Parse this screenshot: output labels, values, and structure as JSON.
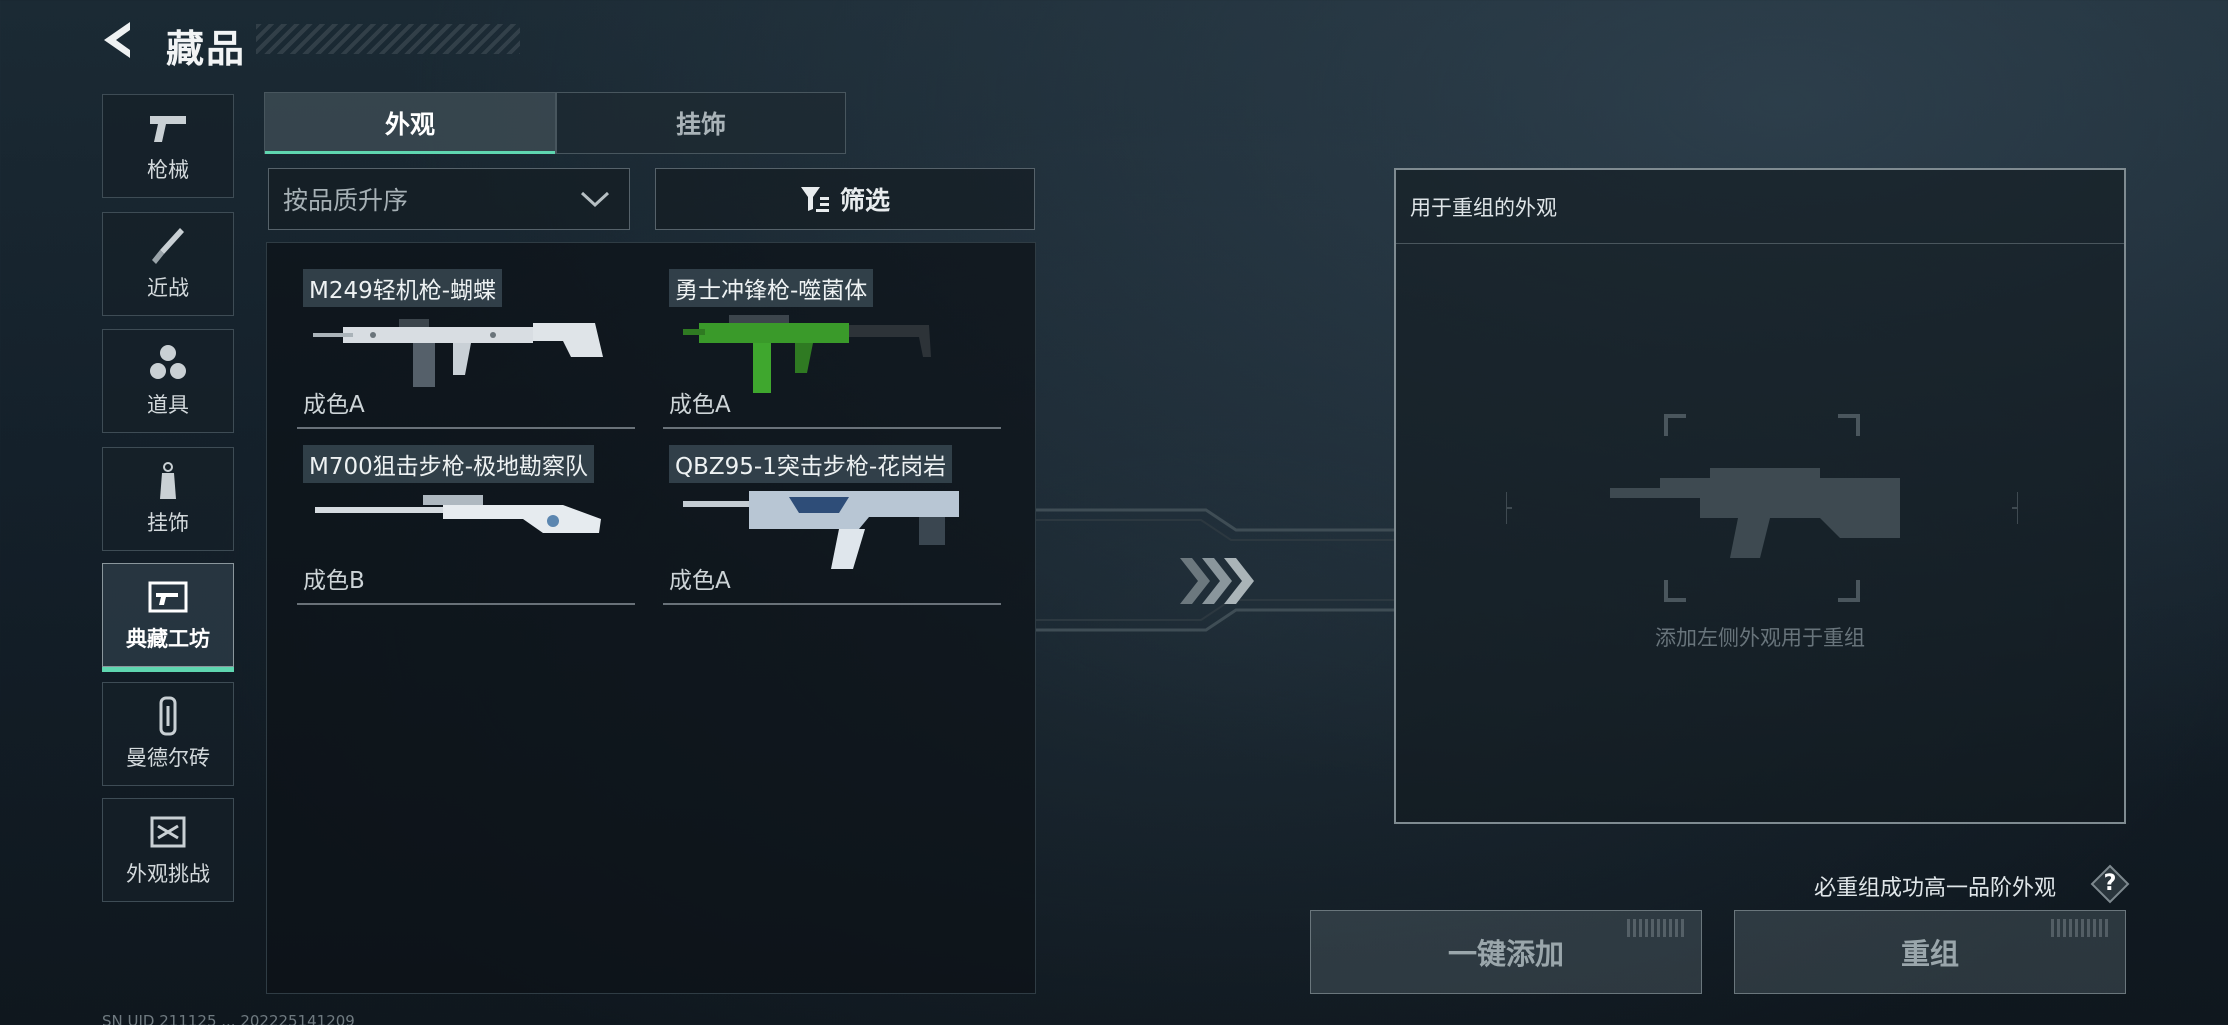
{
  "header": {
    "title": "藏品"
  },
  "sidebar": {
    "items": [
      {
        "label": "枪械",
        "icon": "pistol-icon"
      },
      {
        "label": "近战",
        "icon": "knife-icon"
      },
      {
        "label": "道具",
        "icon": "grenade-cluster-icon"
      },
      {
        "label": "挂饰",
        "icon": "charm-tag-icon"
      },
      {
        "label": "典藏工坊",
        "icon": "gun-frame-icon",
        "active": true
      },
      {
        "label": "曼德尔砖",
        "icon": "brick-icon"
      },
      {
        "label": "外观挑战",
        "icon": "challenge-map-icon"
      }
    ]
  },
  "tabs": [
    {
      "label": "外观",
      "active": true
    },
    {
      "label": "挂饰",
      "active": false
    }
  ],
  "sort": {
    "label": "按品质升序"
  },
  "filter": {
    "label": "筛选"
  },
  "items": [
    {
      "name": "M249轻机枪-蝴蝶",
      "grade": "成色A",
      "skin_color": "#d8dde2"
    },
    {
      "name": "勇士冲锋枪-噬菌体",
      "grade": "成色A",
      "skin_color": "#3a9a2a"
    },
    {
      "name": "M700狙击步枪-极地勘察队",
      "grade": "成色B",
      "skin_color": "#e6ebef"
    },
    {
      "name": "QBZ95-1突击步枪-花岗岩",
      "grade": "成色A",
      "skin_color": "#b8c6d4"
    }
  ],
  "recombine": {
    "title": "用于重组的外观",
    "placeholder": "添加左侧外观用于重组",
    "guarantee": "必重组成功高一品阶外观",
    "help": "?",
    "add_button": "一键添加",
    "recombine_button": "重组"
  },
  "status_bar": "SN UID 211125 ... 202225141209",
  "colors": {
    "accent": "#5fd6b0"
  }
}
